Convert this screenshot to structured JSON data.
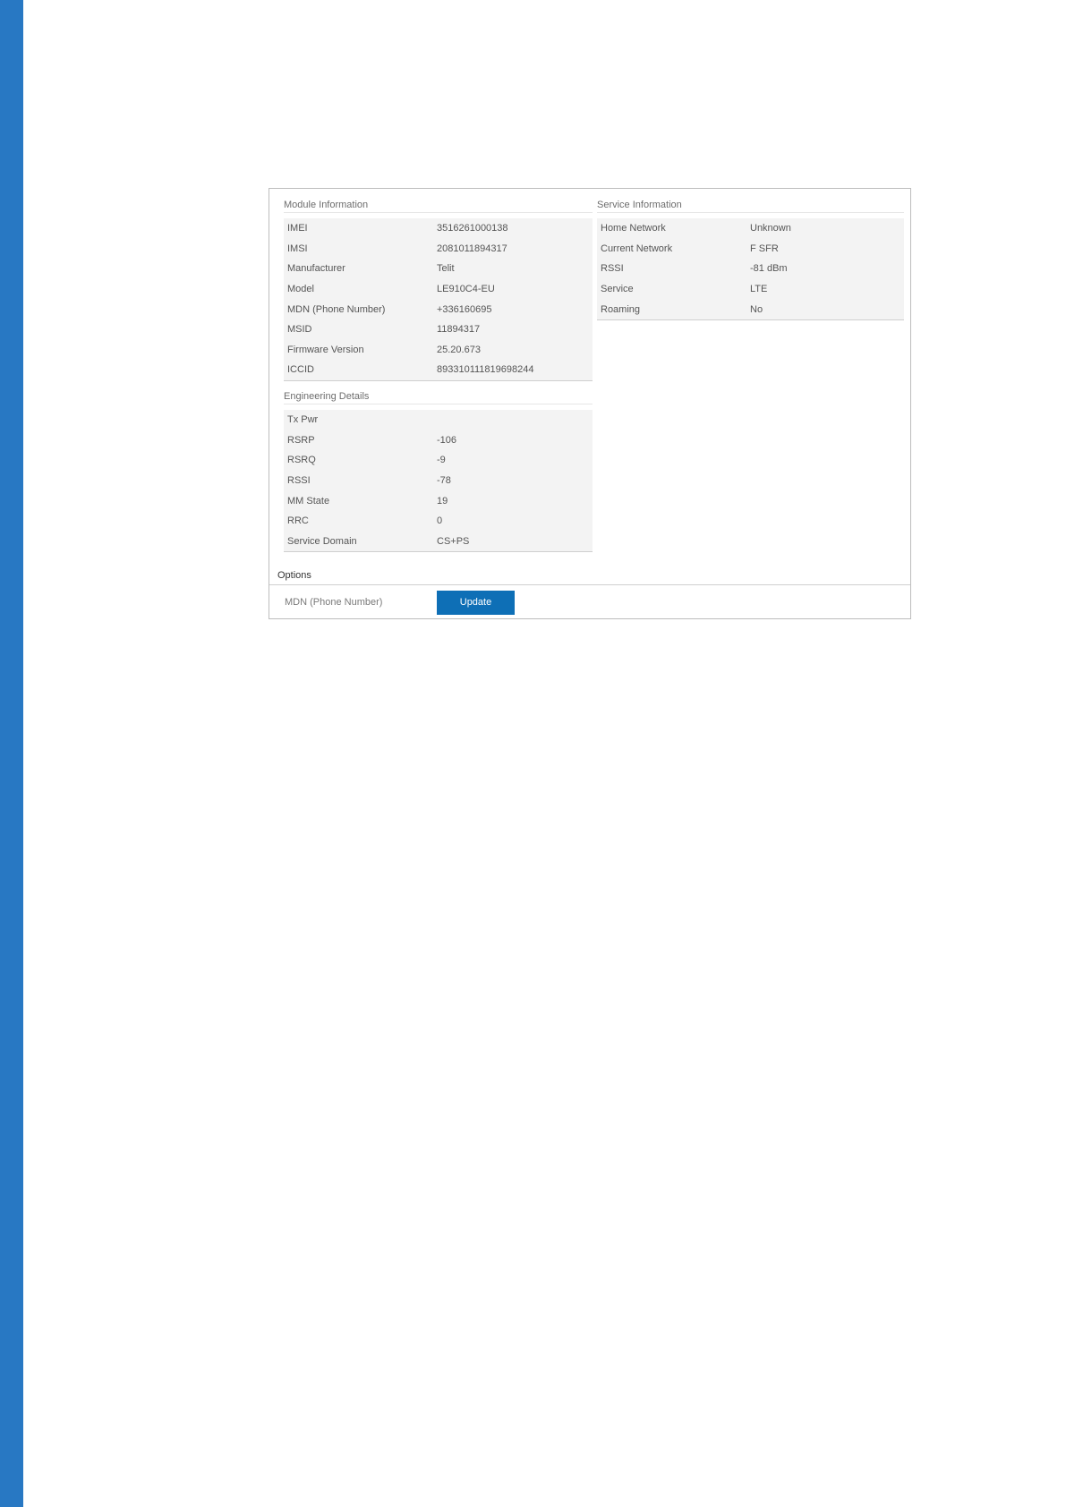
{
  "module_information": {
    "title": "Module Information",
    "rows": [
      {
        "key": "IMEI",
        "value": "3516261000138"
      },
      {
        "key": "IMSI",
        "value": "2081011894317"
      },
      {
        "key": "Manufacturer",
        "value": "Telit"
      },
      {
        "key": "Model",
        "value": "LE910C4-EU"
      },
      {
        "key": "MDN (Phone Number)",
        "value": "+336160695"
      },
      {
        "key": "MSID",
        "value": "11894317"
      },
      {
        "key": "Firmware Version",
        "value": "25.20.673"
      },
      {
        "key": "ICCID",
        "value": "893310111819698244"
      }
    ]
  },
  "engineering_details": {
    "title": "Engineering Details",
    "rows": [
      {
        "key": "Tx Pwr",
        "value": ""
      },
      {
        "key": "RSRP",
        "value": "-106"
      },
      {
        "key": "RSRQ",
        "value": "-9"
      },
      {
        "key": "RSSI",
        "value": "-78"
      },
      {
        "key": "MM State",
        "value": "19"
      },
      {
        "key": "RRC",
        "value": "0"
      },
      {
        "key": "Service Domain",
        "value": "CS+PS"
      }
    ]
  },
  "service_information": {
    "title": "Service Information",
    "rows": [
      {
        "key": "Home Network",
        "value": "Unknown"
      },
      {
        "key": "Current Network",
        "value": "F SFR"
      },
      {
        "key": "RSSI",
        "value": "-81 dBm"
      },
      {
        "key": "Service",
        "value": "LTE"
      },
      {
        "key": "Roaming",
        "value": "No"
      }
    ]
  },
  "options": {
    "title": "Options",
    "mdn_label": "MDN (Phone Number)",
    "update_label": "Update"
  },
  "colors": {
    "accent_bar": "#2878c3",
    "button": "#0e6fb6"
  }
}
